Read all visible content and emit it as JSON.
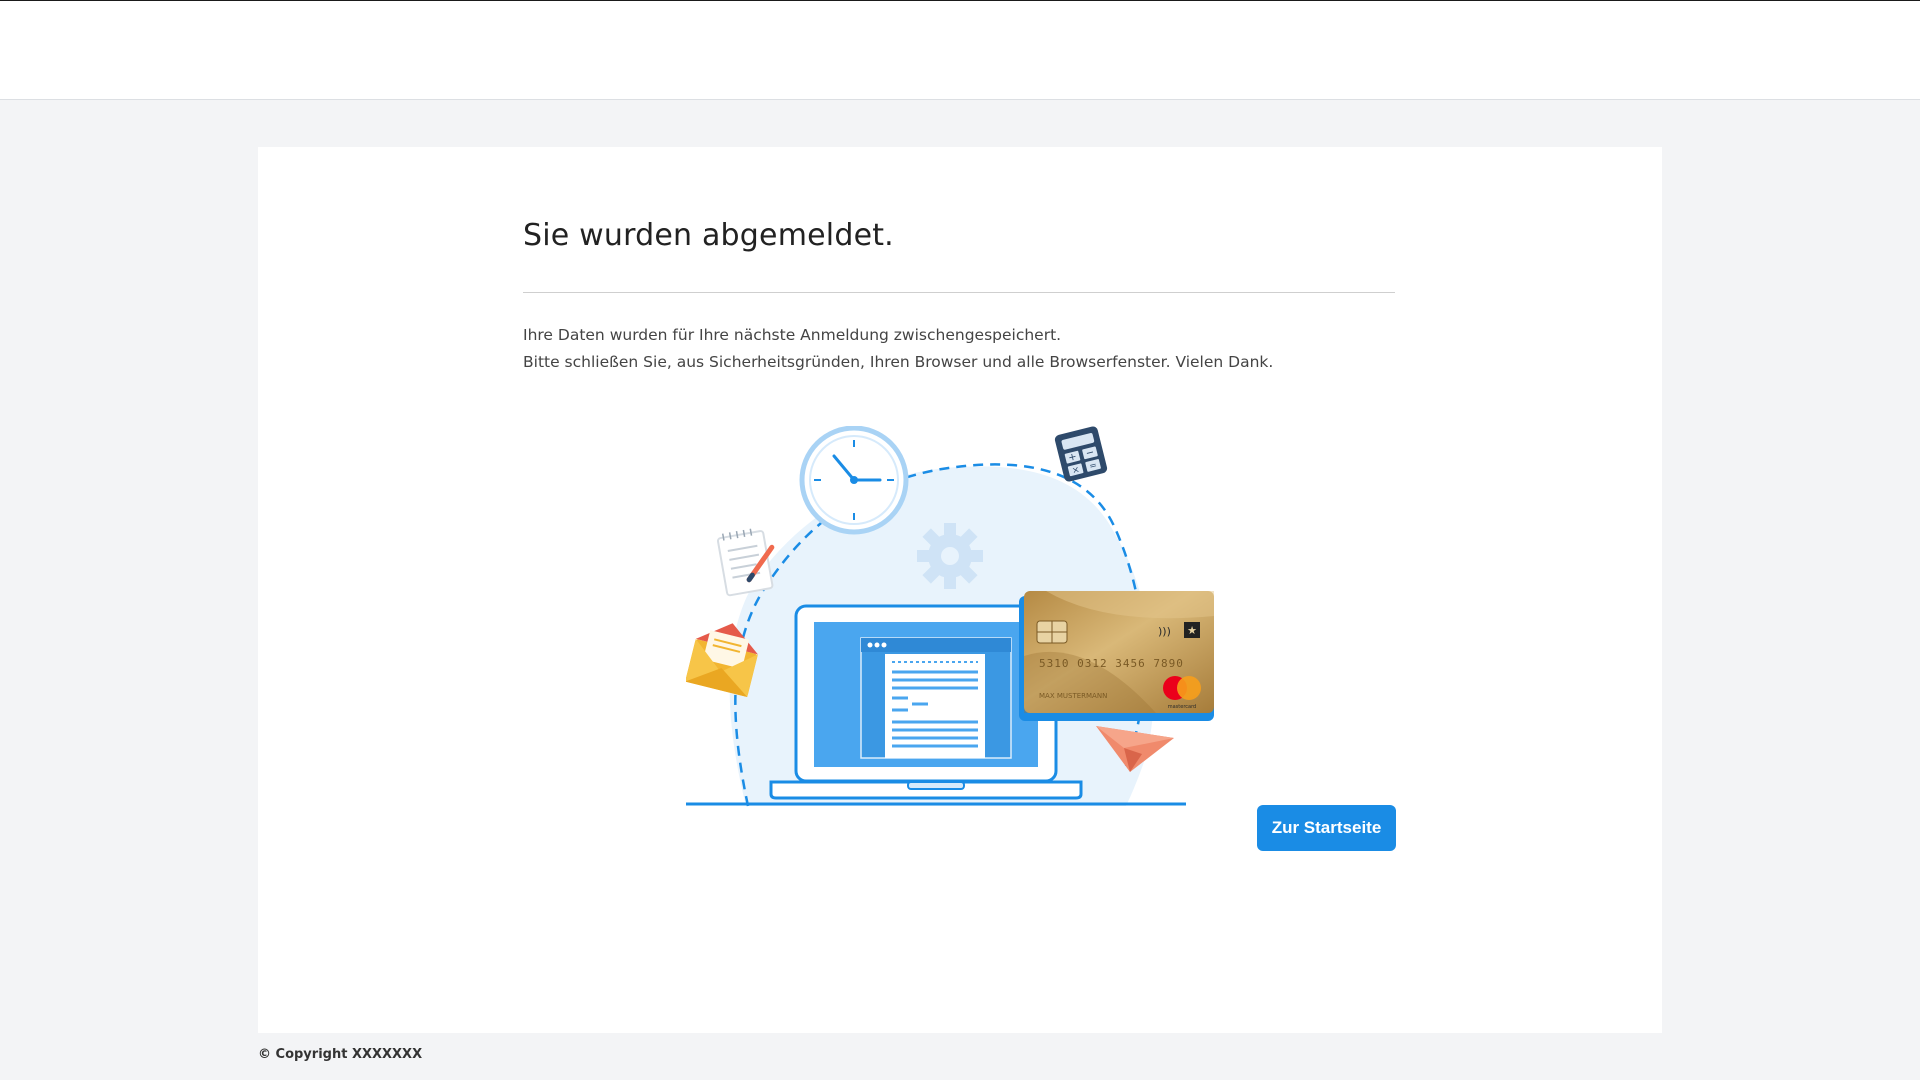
{
  "header": {},
  "main": {
    "title": "Sie wurden abgemeldet.",
    "message_line1": "Ihre Daten wurden für Ihre nächste Anmeldung zwischengespeichert.",
    "message_line2": "Bitte schließen Sie, aus Sicherheitsgründen, Ihren Browser und alle Browserfenster. Vielen Dank.",
    "home_button_label": "Zur Startseite"
  },
  "illustration": {
    "icons": [
      "clock-icon",
      "calculator-icon",
      "gear-icon",
      "notepad-icon",
      "envelope-icon",
      "laptop-icon",
      "credit-card-icon",
      "paper-plane-icon"
    ],
    "card_number": "5310 0312 3456 7890",
    "card_holder": "MAX MUSTERMANN",
    "card_brand": "mastercard"
  },
  "footer": {
    "copyright": "© Copyright XXXXXXX"
  },
  "colors": {
    "accent": "#1a8ce5",
    "page_background": "#f3f4f6",
    "card_background": "#ffffff",
    "card_gold": "#c9a45a"
  }
}
